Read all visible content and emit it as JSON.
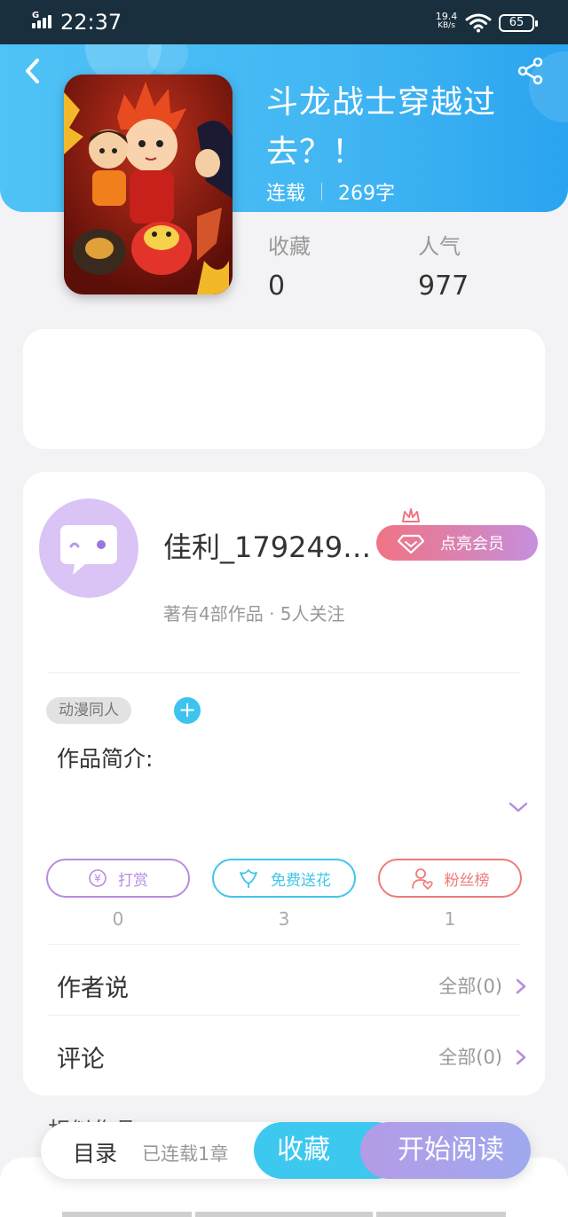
{
  "status_bar": {
    "network": "G",
    "time": "22:37",
    "speed_value": "19.4",
    "speed_unit": "KB/s",
    "battery": "65"
  },
  "header": {
    "title": "斗龙战士穿越过去？！",
    "status": "连载",
    "word_count": "269字",
    "back_icon": "back-arrow-icon",
    "share_icon": "share-icon"
  },
  "stats": {
    "favorites_label": "收藏",
    "favorites_value": "0",
    "popularity_label": "人气",
    "popularity_value": "977"
  },
  "author": {
    "name": "佳利_179249…",
    "meta": "著有4部作品 · 5人关注",
    "vip_label": "点亮会员"
  },
  "work": {
    "tag": "动漫同人",
    "tag_add": "+",
    "intro_label": "作品简介:"
  },
  "actions": [
    {
      "label": "打赏",
      "count": "0",
      "icon": "yen-coin-icon",
      "color": "#b88be0"
    },
    {
      "label": "免费送花",
      "count": "3",
      "icon": "flower-icon",
      "color": "#3fc6ea"
    },
    {
      "label": "粉丝榜",
      "count": "1",
      "icon": "fan-heart-icon",
      "color": "#ef7a7a"
    }
  ],
  "rows": {
    "author_says_label": "作者说",
    "author_says_link": "全部(0)",
    "comments_label": "评论",
    "comments_link": "全部(0)"
  },
  "similar_label": "相似作品",
  "bottom_bar": {
    "toc": "目录",
    "chapters": "已连载1章",
    "collect": "收藏",
    "read": "开始阅读"
  },
  "colors": {
    "header_gradient_start": "#4fc3f7",
    "header_gradient_end": "#2aa4f0",
    "collect_button": "#3cc8ef",
    "read_button": "#b49be6",
    "accent_purple": "#b88be0"
  }
}
